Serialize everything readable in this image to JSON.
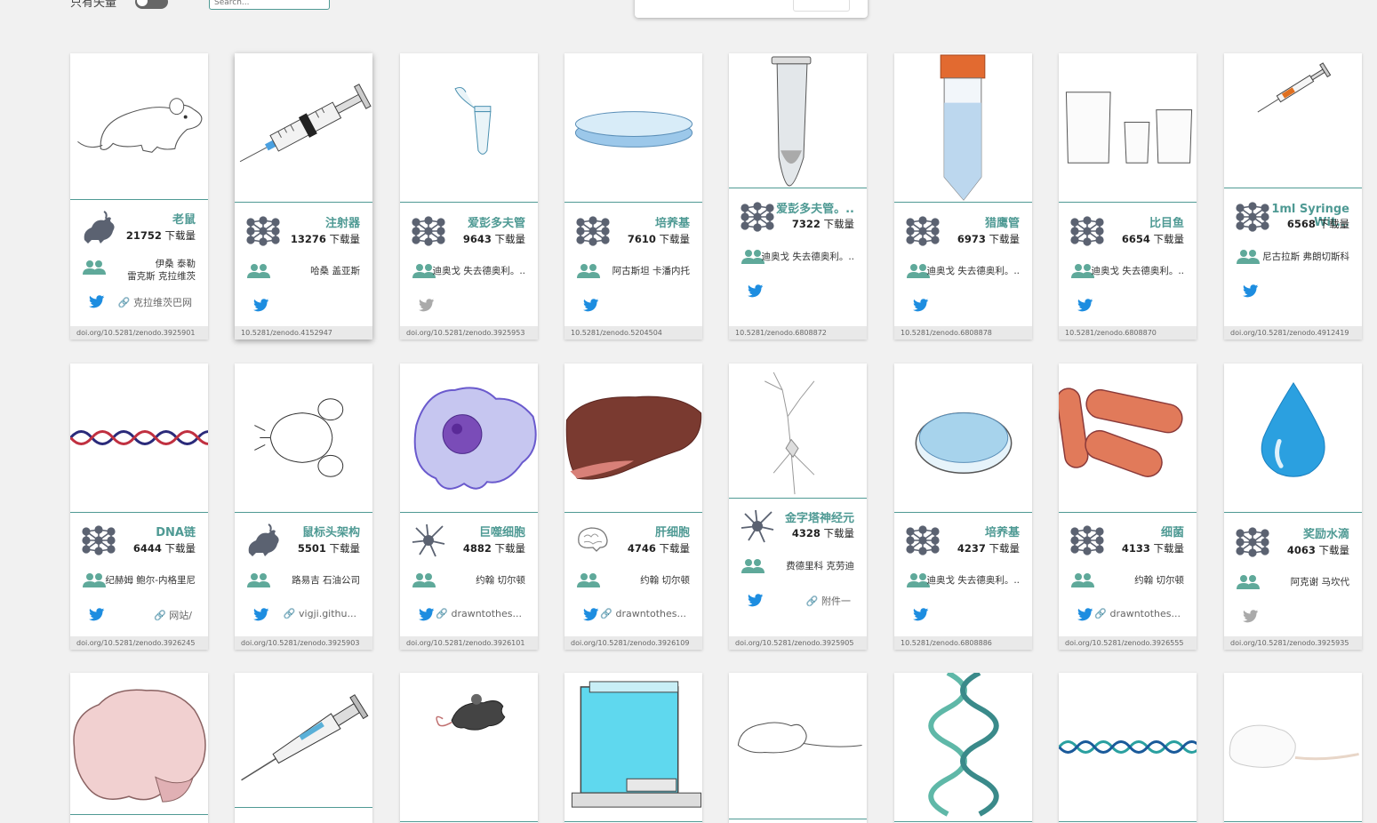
{
  "topbar": {
    "toggle_label": "只有矢量",
    "search_placeholder": "Search..."
  },
  "colors": {
    "accent": "#4f9a94",
    "twitter": "#1d8de0",
    "avatar": "#5b6271",
    "page_bg": "#f1f1f1"
  },
  "dl_suffix": "下载量",
  "cards": [
    {
      "title": "老鼠",
      "downloads": "21752",
      "authors_line1": "伊桑 泰勒",
      "authors_line2": "雷克斯 克拉维茨",
      "link": "克拉维茨巴网",
      "doi": "doi.org/10.5281/zenodo.3925901",
      "image": "mouse-outline",
      "avatar": "mouse-avatar",
      "twitter": true
    },
    {
      "title": "注射器",
      "downloads": "13276",
      "authors_line1": "哈桑 盖亚斯",
      "authors_line2": "",
      "link": "",
      "doi": "10.5281/zenodo.4152947",
      "image": "syringe",
      "avatar": "network-avatar",
      "twitter": true
    },
    {
      "title": "爱彭多夫管",
      "downloads": "9643",
      "authors_line1": "迪奥戈 失去德奥利。..",
      "authors_line2": "",
      "link": "",
      "doi": "doi.org/10.5281/zenodo.3925953",
      "image": "eppendorf-small",
      "avatar": "network-avatar",
      "twitter": false
    },
    {
      "title": "培养基",
      "downloads": "7610",
      "authors_line1": "阿古斯坦 卡潘内托",
      "authors_line2": "",
      "link": "",
      "doi": "10.5281/zenodo.5204504",
      "image": "petri-flat",
      "avatar": "network-avatar",
      "twitter": true
    },
    {
      "title": "爱彭多夫管。..",
      "downloads": "7322",
      "authors_line1": "迪奥戈 失去德奥利。..",
      "authors_line2": "",
      "link": "",
      "doi": "10.5281/zenodo.6808872",
      "image": "eppendorf-tube",
      "avatar": "network-avatar",
      "twitter": true
    },
    {
      "title": "猎鹰管",
      "downloads": "6973",
      "authors_line1": "迪奥戈 失去德奥利。..",
      "authors_line2": "",
      "link": "",
      "doi": "10.5281/zenodo.6808878",
      "image": "falcon-tube",
      "avatar": "network-avatar",
      "twitter": true
    },
    {
      "title": "比目鱼",
      "downloads": "6654",
      "authors_line1": "迪奥戈 失去德奥利。..",
      "authors_line2": "",
      "link": "",
      "doi": "10.5281/zenodo.6808870",
      "image": "beakers",
      "avatar": "network-avatar",
      "twitter": true
    },
    {
      "title": "1ml Syringe Wit...",
      "downloads": "6568",
      "authors_line1": "尼古拉斯 弗朗切斯科",
      "authors_line2": "",
      "link": "",
      "doi": "doi.org/10.5281/zenodo.4912419",
      "image": "syringe-small",
      "avatar": "network-avatar",
      "twitter": true
    },
    {
      "title": "DNA链",
      "downloads": "6444",
      "authors_line1": "纪赫姆 鲍尔-内格里尼",
      "authors_line2": "",
      "link": "网站/",
      "doi": "doi.org/10.5281/zenodo.3926245",
      "image": "dna-strand",
      "avatar": "network-avatar",
      "twitter": true
    },
    {
      "title": "鼠标头架构",
      "downloads": "5501",
      "authors_line1": "路易吉 石油公司",
      "authors_line2": "",
      "link": "vigji.githu...",
      "doi": "doi.org/10.5281/zenodo.3925903",
      "image": "mouse-head",
      "avatar": "mouse-avatar",
      "twitter": true
    },
    {
      "title": "巨噬细胞",
      "downloads": "4882",
      "authors_line1": "约翰 切尔顿",
      "authors_line2": "",
      "link": "drawntothes...",
      "doi": "doi.org/10.5281/zenodo.3926101",
      "image": "macrophage",
      "avatar": "neuron-avatar",
      "twitter": true
    },
    {
      "title": "肝细胞",
      "downloads": "4746",
      "authors_line1": "约翰 切尔顿",
      "authors_line2": "",
      "link": "drawntothes...",
      "doi": "doi.org/10.5281/zenodo.3926109",
      "image": "liver",
      "avatar": "brain-avatar",
      "twitter": true
    },
    {
      "title": "金字塔神经元",
      "downloads": "4328",
      "authors_line1": "费德里科 克劳迪",
      "authors_line2": "",
      "link": "附件一",
      "doi": "doi.org/10.5281/zenodo.3925905",
      "image": "neuron",
      "avatar": "neuron-avatar",
      "twitter": true
    },
    {
      "title": "培养基",
      "downloads": "4237",
      "authors_line1": "迪奥戈 失去德奥利。..",
      "authors_line2": "",
      "link": "",
      "doi": "10.5281/zenodo.6808886",
      "image": "petri-dish",
      "avatar": "network-avatar",
      "twitter": true
    },
    {
      "title": "细菌",
      "downloads": "4133",
      "authors_line1": "约翰 切尔顿",
      "authors_line2": "",
      "link": "drawntothes...",
      "doi": "doi.org/10.5281/zenodo.3926555",
      "image": "bacteria",
      "avatar": "network-avatar",
      "twitter": true
    },
    {
      "title": "奖励水滴",
      "downloads": "4063",
      "authors_line1": "阿克谢 马坎代",
      "authors_line2": "",
      "link": "",
      "doi": "doi.org/10.5281/zenodo.3925935",
      "image": "water-drop",
      "avatar": "network-avatar",
      "twitter": false
    },
    {
      "image": "brain"
    },
    {
      "image": "pipette"
    },
    {
      "image": "mouse-dark"
    },
    {
      "image": "balance"
    },
    {
      "image": "rat-outline"
    },
    {
      "image": "dna-vertical"
    },
    {
      "image": "dna-horizontal"
    },
    {
      "image": "mouse-white"
    }
  ]
}
